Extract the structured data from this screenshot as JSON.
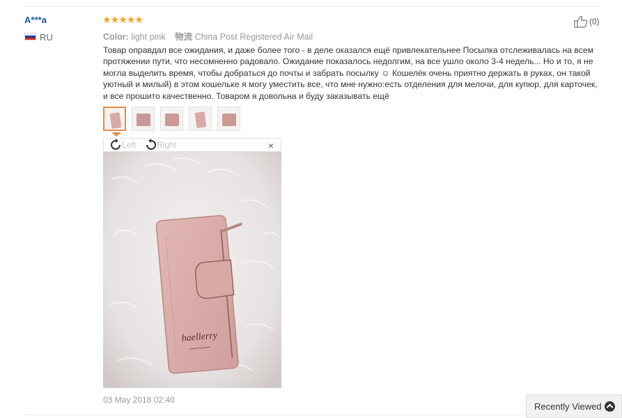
{
  "review": {
    "reviewer": "A***a",
    "country": "RU",
    "flag_colors": [
      "#ffffff",
      "#0039a6",
      "#d52b1e"
    ],
    "rating_stars": "★★★★★",
    "rating": 5,
    "color_label": "Color:",
    "color_value": "light pink",
    "shipping_label": "物流",
    "shipping_value": "China Post Registered Air Mail",
    "helpful_count": "(0)",
    "text": "Товар оправдал все ожидания, и даже более того - в деле оказался ещё привлекательнее Посылка отслеживалась на всем протяжении пути, что несомненно радовало. Ожидание показалось недолгим, на все ушло около 3-4 недель... Но и то, я не могла выделить время, чтобы добраться до почты и забрать посылку ☺ Кошелёк очень приятно держать в руках, он такой уютный и милый) в этом кошельке я могу уместить все, что мне нужно:есть отделения для мелочи, для купюр, для карточек, и все прошито качественно. Товаром я довольна и буду заказывать ещё",
    "date": "03 May 2018 02:40",
    "thumbnails_count": 5,
    "active_thumbnail": 1
  },
  "viewer": {
    "rotate_left_label": "Left",
    "rotate_right_label": "Right",
    "close_symbol": "×",
    "brand_on_wallet": "baellerry"
  },
  "footer": {
    "recently_viewed_label": "Recently Viewed"
  },
  "colors": {
    "reviewer_name": "#1a5aa8",
    "stars": "#f6a51b",
    "active_thumb_border": "#e88a44",
    "wallet": "#d9aaa8"
  }
}
